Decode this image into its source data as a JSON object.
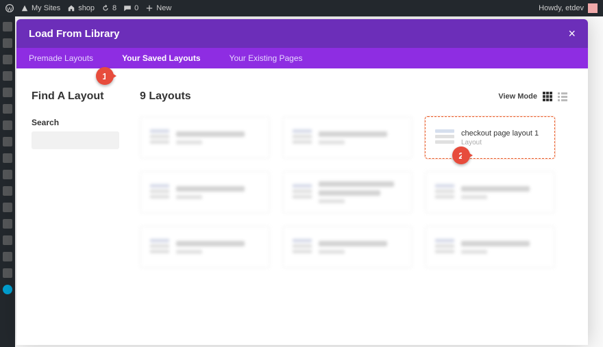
{
  "adminbar": {
    "my_sites": "My Sites",
    "site_name": "shop",
    "updates_count": "8",
    "comments_count": "0",
    "new_label": "New",
    "howdy": "Howdy, etdev"
  },
  "modal": {
    "title": "Load From Library",
    "tabs": {
      "premade": "Premade Layouts",
      "saved": "Your Saved Layouts",
      "existing": "Your Existing Pages"
    },
    "close": "×"
  },
  "sidebar": {
    "find_heading": "Find A Layout",
    "search_label": "Search",
    "search_placeholder": ""
  },
  "results": {
    "heading": "9 Layouts",
    "view_mode_label": "View Mode"
  },
  "highlight_card": {
    "title": "checkout page layout 1",
    "subtitle": "Layout"
  },
  "markers": {
    "m1": "1",
    "m2": "2"
  }
}
